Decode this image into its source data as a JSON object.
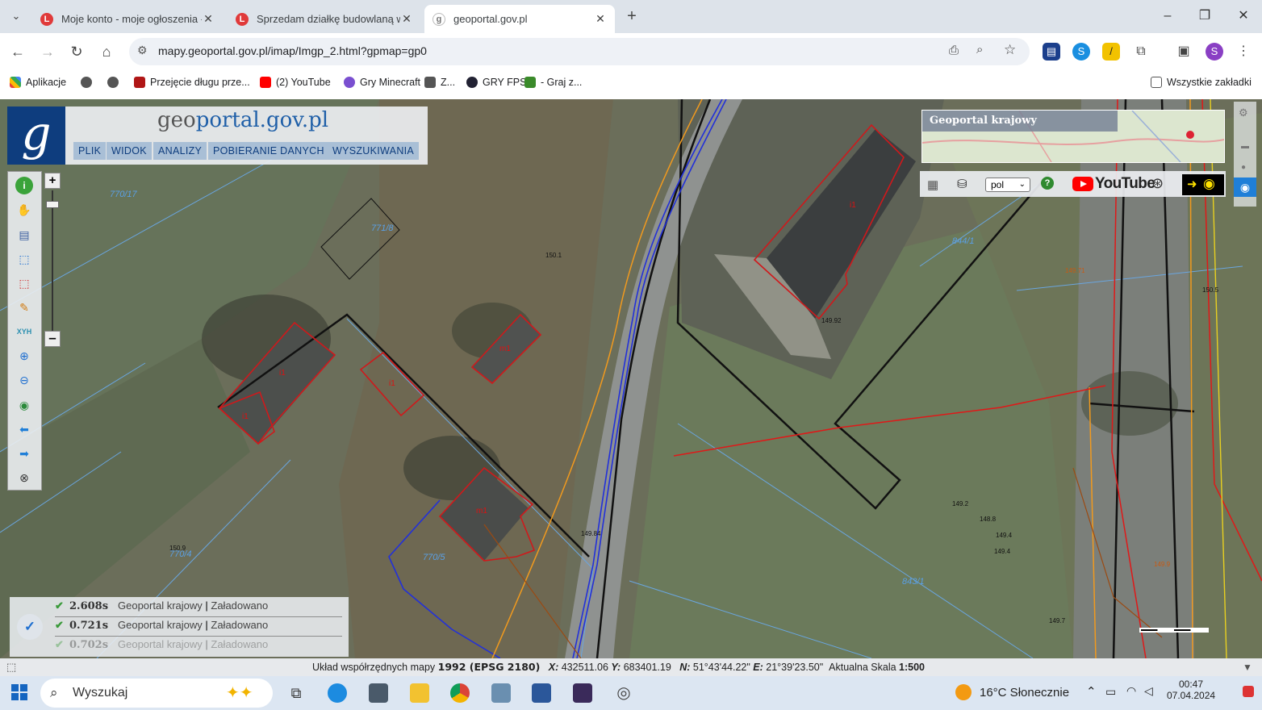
{
  "browser": {
    "tabs": [
      {
        "title": "Moje konto - moje ogłoszenia -",
        "favicon": "L",
        "active": false
      },
      {
        "title": "Sprzedam działkę budowlaną w",
        "favicon": "L",
        "active": false
      },
      {
        "title": "geoportal.gov.pl",
        "favicon": "globe",
        "active": true
      }
    ],
    "url": "mapy.geoportal.gov.pl/imap/Imgp_2.html?gpmap=gp0",
    "profile_initial": "S",
    "bookmarks": [
      {
        "label": "Aplikacje",
        "icon": "apps-icon"
      },
      {
        "label": "",
        "icon": "globe-icon"
      },
      {
        "label": "",
        "icon": "globe-icon"
      },
      {
        "label": "Przejęcie długu prze...",
        "icon": "site-icon"
      },
      {
        "label": "(2) YouTube",
        "icon": "youtube-icon"
      },
      {
        "label": "Gry Minecraft",
        "icon": "game-icon"
      },
      {
        "label": "Z...",
        "icon": "game-icon"
      },
      {
        "label": "GRY FPS",
        "icon": "game-icon"
      },
      {
        "label": "- Graj z...",
        "icon": "game-icon"
      }
    ],
    "all_bookmarks_label": "Wszystkie zakładki"
  },
  "geoportal": {
    "logo_text_1": "geo",
    "logo_text_2": "portal.gov.pl",
    "menu": [
      "PLIK",
      "WIDOK",
      "ANALIZY",
      "POBIERANIE DANYCH",
      "WYSZUKIWANIA"
    ],
    "overview_title": "Geoportal krajowy",
    "language": "pol",
    "youtube_label": "YouTube",
    "status_rows": [
      {
        "time": "2.608s",
        "service": "Geoportal krajowy",
        "status": "Załadowano"
      },
      {
        "time": "0.721s",
        "service": "Geoportal krajowy",
        "status": "Załadowano"
      },
      {
        "time": "0.702s",
        "service": "Geoportal krajowy",
        "status": "Załadowano"
      }
    ],
    "coords": {
      "system_label": "Układ współrzędnych mapy",
      "system_value": "1992 (EPSG 2180)",
      "x_label": "X:",
      "x_value": "432511.06",
      "y_label": "Y:",
      "y_value": "683401.19",
      "n_label": "N:",
      "n_value": "51°43'44.22\"",
      "e_label": "E:",
      "e_value": "21°39'23.50\"",
      "scale_label": "Aktualna Skala",
      "scale_value": "1:500"
    },
    "parcel_labels": [
      "770/17",
      "771/8",
      "770/4",
      "770/5",
      "844/1",
      "843/1"
    ],
    "building_labels": [
      "i1",
      "i1",
      "i1",
      "m1",
      "m1",
      "i1"
    ],
    "height_labels": [
      "150.1",
      "149.92",
      "149.84",
      "150.9",
      "149.4",
      "149.2",
      "149.7",
      "148.8",
      "149.4",
      "149.71",
      "149.9",
      "150.5"
    ]
  },
  "taskbar": {
    "search_placeholder": "Wyszukaj",
    "weather": "16°C  Słonecznie",
    "time": "00:47",
    "date": "07.04.2024"
  }
}
